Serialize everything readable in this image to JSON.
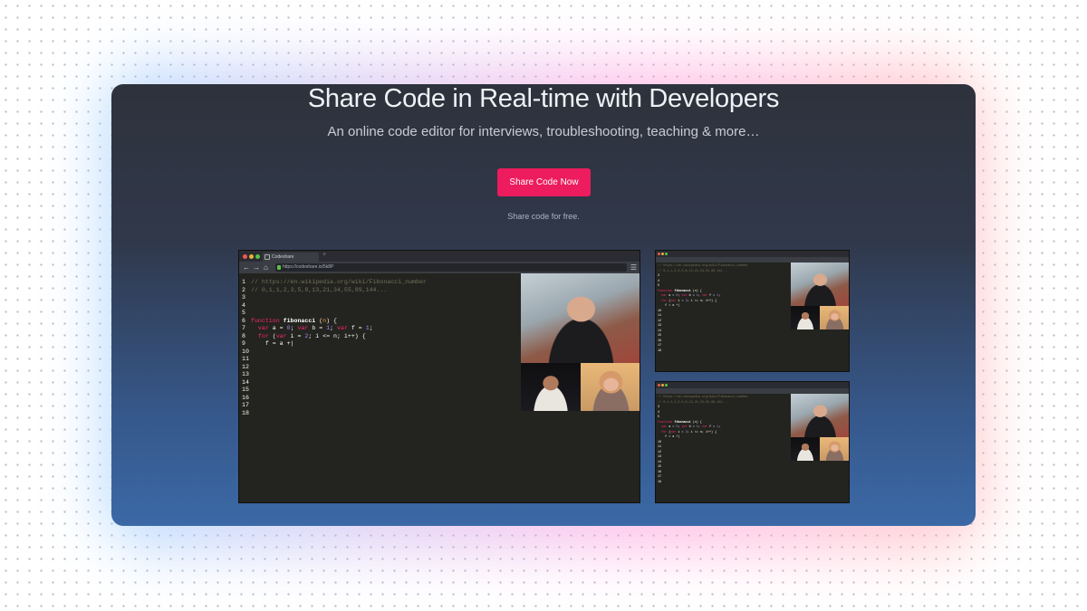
{
  "hero": {
    "title": "Share Code in Real-time with Developers",
    "subtitle": "An online code editor for interviews, troubleshooting, teaching & more…",
    "cta_label": "Share Code Now",
    "note": "Share code for free."
  },
  "browser": {
    "tab_title": "Codeshare",
    "url": "https://codeshare.io/5k8P",
    "code_lines": [
      "// https://en.wikipedia.org/wiki/Fibonacci_number",
      "// 0,1,1,2,3,5,8,13,21,34,55,89,144...",
      "",
      "",
      "",
      "function fibonacci (n) {",
      "  var a = 0; var b = 1; var f = 1;",
      "  for (var i = 2; i <= n; i++) {",
      "    f = a +",
      "",
      "",
      "",
      "",
      "",
      "",
      "",
      "",
      ""
    ]
  },
  "colors": {
    "cta": "#ec1c5e",
    "hero_top": "#2e323c",
    "hero_bottom": "#3b69a6"
  }
}
